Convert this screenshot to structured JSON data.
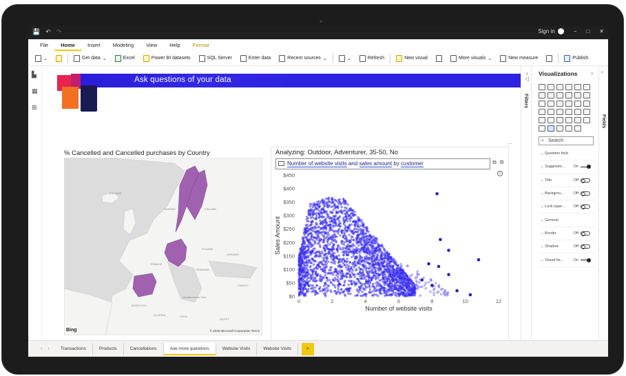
{
  "window": {
    "quick_access": [
      "💾",
      "↶",
      "↷"
    ],
    "signin": "Sign in",
    "controls": [
      "−",
      "□",
      "✕"
    ]
  },
  "ribbon_tabs": [
    "File",
    "Home",
    "Insert",
    "Modeling",
    "View",
    "Help",
    "Format"
  ],
  "ribbon_active": "Home",
  "toolbar": {
    "get_data": "Get data",
    "excel": "Excel",
    "pbi_datasets": "Power BI datasets",
    "sql": "SQL Server",
    "enter_data": "Enter data",
    "recent": "Recent sources",
    "refresh": "Refresh",
    "new_visual": "New visual",
    "more_visuals": "More visuals",
    "new_measure": "New measure",
    "publish": "Publish"
  },
  "banner": {
    "title": "Ask questions of your data",
    "color": "#2d23e0"
  },
  "map": {
    "title": "% Cancelled and Cancelled purchases by Country",
    "bing": "Bing",
    "copyright": "© 2020 Microsoft Corporation Terms",
    "highlight_color": "#a062b0",
    "labels": [
      "ICELAND",
      "NORWAY",
      "FINLAND",
      "POLAND",
      "UKRAINE",
      "FRANCE",
      "ROMANIA",
      "TURKEY",
      "MOROCCO",
      "ALGERIA",
      "LIBYA",
      "EGYPT",
      "Mediterranean Sea"
    ]
  },
  "qa": {
    "analyzing": "Analyzing: Outdoor, Adventurer, 35-50, No",
    "question_parts": [
      "Number of website visits",
      " and ",
      "sales amount",
      " by ",
      "customer"
    ],
    "more": "..."
  },
  "chart_data": {
    "type": "scatter",
    "xlabel": "Number of website visits",
    "ylabel": "Sales Amount",
    "xlim": [
      0,
      12
    ],
    "ylim": [
      0,
      450
    ],
    "xticks": [
      0,
      2,
      4,
      6,
      8,
      10,
      12
    ],
    "yticks": [
      "$0",
      "$50",
      "$100",
      "$150",
      "$200",
      "$250",
      "$300",
      "$350",
      "$400",
      "$450"
    ],
    "color": "#3b30f0",
    "dense_cloud": {
      "x_range": [
        0,
        7
      ],
      "y_peak": 370
    },
    "outliers": [
      {
        "x": 8.3,
        "y": 380
      },
      {
        "x": 8.5,
        "y": 210
      },
      {
        "x": 9.0,
        "y": 170
      },
      {
        "x": 10.8,
        "y": 135
      },
      {
        "x": 8.4,
        "y": 110
      },
      {
        "x": 9.0,
        "y": 80
      },
      {
        "x": 7.8,
        "y": 120
      },
      {
        "x": 7.4,
        "y": 60
      },
      {
        "x": 8.0,
        "y": 40
      },
      {
        "x": 10.3,
        "y": 5
      },
      {
        "x": 9.5,
        "y": 20
      }
    ]
  },
  "panes": {
    "filters": "Filters",
    "visualizations": "Visualizations",
    "fields": "Fields",
    "search_placeholder": "Search",
    "properties": [
      {
        "label": "Question field",
        "value": "",
        "toggle": "none"
      },
      {
        "label": "Suggestio...",
        "value": "On",
        "toggle": "on"
      },
      {
        "label": "Title",
        "value": "Off",
        "toggle": "off"
      },
      {
        "label": "Backgrou...",
        "value": "Off",
        "toggle": "off"
      },
      {
        "label": "Lock aspe...",
        "value": "Off",
        "toggle": "off"
      },
      {
        "label": "General",
        "value": "",
        "toggle": "none"
      },
      {
        "label": "Border",
        "value": "Off",
        "toggle": "off"
      },
      {
        "label": "Shadow",
        "value": "Off",
        "toggle": "off"
      },
      {
        "label": "Visual he...",
        "value": "On",
        "toggle": "on"
      }
    ]
  },
  "page_tabs": [
    "Transactions",
    "Products",
    "Cancellations",
    "Ask more questions",
    "Website Visits",
    "Website Visits"
  ],
  "page_active": "Ask more questions",
  "page_add": "+",
  "back_arrow": "←"
}
